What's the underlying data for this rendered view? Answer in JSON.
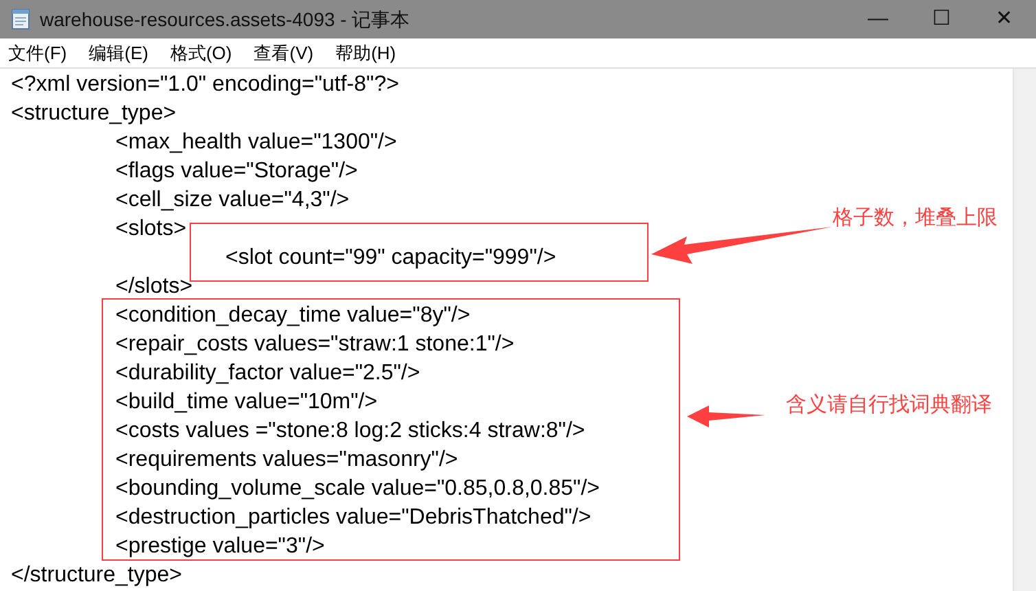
{
  "window": {
    "title": "warehouse-resources.assets-4093 - 记事本",
    "controls": [
      "—",
      "☐",
      "✕"
    ]
  },
  "menu": [
    {
      "label": "文件(F)"
    },
    {
      "label": "编辑(E)"
    },
    {
      "label": "格式(O)"
    },
    {
      "label": "查看(V)"
    },
    {
      "label": "帮助(H)"
    }
  ],
  "lines": [
    {
      "text": "<?xml version=\"1.0\" encoding=\"utf-8\"?>"
    },
    {
      "text": "<structure_type>",
      "children": [
        {
          "text": "<max_health value=\"1300\"/>"
        },
        {
          "text": "<flags value=\"Storage\"/>"
        },
        {
          "text": "<cell_size value=\"4,3\"/>"
        },
        {
          "text": "<slots>",
          "children": [
            {
              "text": "<slot count=\"99\" capacity=\"999\"/>"
            }
          ]
        },
        {
          "text": "</slots>"
        },
        {
          "text": "<condition_decay_time value=\"8y\"/>"
        },
        {
          "text": "<repair_costs values=\"straw:1 stone:1\"/>"
        },
        {
          "text": "<durability_factor value=\"2.5\"/>"
        },
        {
          "text": "<build_time value=\"10m\"/>"
        },
        {
          "text": "<costs values =\"stone:8 log:2 sticks:4 straw:8\"/>"
        },
        {
          "text": "<requirements values=\"masonry\"/>"
        },
        {
          "text": "<bounding_volume_scale value=\"0.85,0.8,0.85\"/>"
        },
        {
          "text": "<destruction_particles value=\"DebrisThatched\"/>"
        },
        {
          "text": "<prestige value=\"3\"/>"
        }
      ]
    },
    {
      "text": "</structure_type>"
    }
  ],
  "annotations": [
    {
      "text": "格子数，堆叠上限"
    },
    {
      "text": "含义请自行找词典翻译"
    }
  ]
}
